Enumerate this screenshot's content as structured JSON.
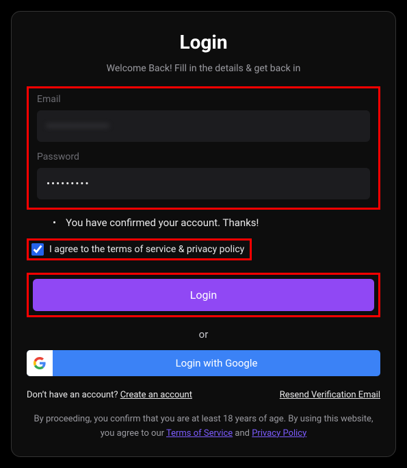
{
  "title": "Login",
  "subtitle": "Welcome Back! Fill in the details & get back in",
  "email": {
    "label": "Email",
    "value": "••••••••••••••••••"
  },
  "password": {
    "label": "Password",
    "value": "•••••••••"
  },
  "confirmed_msg": "You have confirmed your account. Thanks!",
  "agree_label": "I agree to the terms of service & privacy policy",
  "agree_checked": true,
  "login_label": "Login",
  "or_label": "or",
  "google_label": "Login with Google",
  "noacc_text": "Don’t have an account? ",
  "create_label": "Create an account",
  "resend_label": "Resend Verification Email",
  "disclaimer_prefix": "By proceeding, you confirm that you are at least 18 years of age. By using this website, you agree to our ",
  "tos_label": "Terms of Service",
  "disclaimer_and": " and ",
  "privacy_label": "Privacy Policy",
  "colors": {
    "accent": "#9048f4",
    "google": "#3b82f6",
    "link": "#7c5cff"
  }
}
